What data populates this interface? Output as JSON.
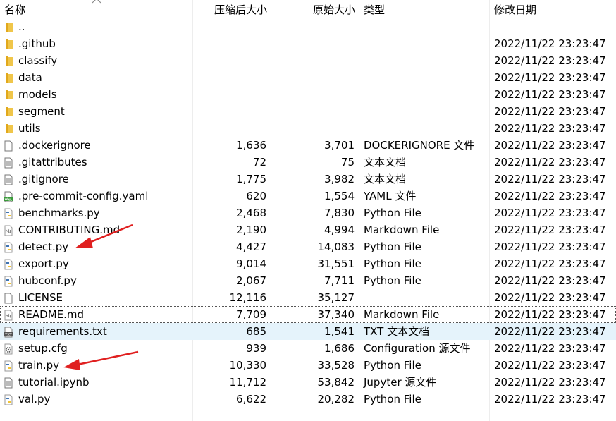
{
  "columns": {
    "name": "名称",
    "compressed": "压缩后大小",
    "original": "原始大小",
    "type": "类型",
    "modified": "修改日期"
  },
  "rows": [
    {
      "name": "..",
      "compressed": "",
      "original": "",
      "type": "",
      "modified": "",
      "icon": "folder-icon"
    },
    {
      "name": ".github",
      "compressed": "",
      "original": "",
      "type": "",
      "modified": "2022/11/22 23:23:47",
      "icon": "folder-icon"
    },
    {
      "name": "classify",
      "compressed": "",
      "original": "",
      "type": "",
      "modified": "2022/11/22 23:23:47",
      "icon": "folder-icon"
    },
    {
      "name": "data",
      "compressed": "",
      "original": "",
      "type": "",
      "modified": "2022/11/22 23:23:47",
      "icon": "folder-icon"
    },
    {
      "name": "models",
      "compressed": "",
      "original": "",
      "type": "",
      "modified": "2022/11/22 23:23:47",
      "icon": "folder-icon"
    },
    {
      "name": "segment",
      "compressed": "",
      "original": "",
      "type": "",
      "modified": "2022/11/22 23:23:47",
      "icon": "folder-icon"
    },
    {
      "name": "utils",
      "compressed": "",
      "original": "",
      "type": "",
      "modified": "2022/11/22 23:23:47",
      "icon": "folder-icon"
    },
    {
      "name": ".dockerignore",
      "compressed": "1,636",
      "original": "3,701",
      "type": "DOCKERIGNORE 文件",
      "modified": "2022/11/22 23:23:47",
      "icon": "blank-file-icon"
    },
    {
      "name": ".gitattributes",
      "compressed": "72",
      "original": "75",
      "type": "文本文档",
      "modified": "2022/11/22 23:23:47",
      "icon": "text-file-icon"
    },
    {
      "name": ".gitignore",
      "compressed": "1,775",
      "original": "3,982",
      "type": "文本文档",
      "modified": "2022/11/22 23:23:47",
      "icon": "text-file-icon"
    },
    {
      "name": ".pre-commit-config.yaml",
      "compressed": "620",
      "original": "1,554",
      "type": "YAML 文件",
      "modified": "2022/11/22 23:23:47",
      "icon": "yaml-file-icon"
    },
    {
      "name": "benchmarks.py",
      "compressed": "2,468",
      "original": "7,830",
      "type": "Python File",
      "modified": "2022/11/22 23:23:47",
      "icon": "python-file-icon"
    },
    {
      "name": "CONTRIBUTING.md",
      "compressed": "2,190",
      "original": "4,994",
      "type": "Markdown File",
      "modified": "2022/11/22 23:23:47",
      "icon": "markdown-file-icon"
    },
    {
      "name": "detect.py",
      "compressed": "4,427",
      "original": "14,083",
      "type": "Python File",
      "modified": "2022/11/22 23:23:47",
      "icon": "python-file-icon"
    },
    {
      "name": "export.py",
      "compressed": "9,014",
      "original": "31,551",
      "type": "Python File",
      "modified": "2022/11/22 23:23:47",
      "icon": "python-file-icon"
    },
    {
      "name": "hubconf.py",
      "compressed": "2,067",
      "original": "7,711",
      "type": "Python File",
      "modified": "2022/11/22 23:23:47",
      "icon": "python-file-icon"
    },
    {
      "name": "LICENSE",
      "compressed": "12,116",
      "original": "35,127",
      "type": "",
      "modified": "2022/11/22 23:23:47",
      "icon": "blank-file-icon"
    },
    {
      "name": "README.md",
      "compressed": "7,709",
      "original": "37,340",
      "type": "Markdown File",
      "modified": "2022/11/22 23:23:47",
      "icon": "markdown-file-icon"
    },
    {
      "name": "requirements.txt",
      "compressed": "685",
      "original": "1,541",
      "type": "TXT 文本文档",
      "modified": "2022/11/22 23:23:47",
      "icon": "txt-file-icon"
    },
    {
      "name": "setup.cfg",
      "compressed": "939",
      "original": "1,686",
      "type": "Configuration 源文件",
      "modified": "2022/11/22 23:23:47",
      "icon": "config-file-icon"
    },
    {
      "name": "train.py",
      "compressed": "10,330",
      "original": "33,528",
      "type": "Python File",
      "modified": "2022/11/22 23:23:47",
      "icon": "python-file-icon"
    },
    {
      "name": "tutorial.ipynb",
      "compressed": "11,712",
      "original": "53,842",
      "type": "Jupyter 源文件",
      "modified": "2022/11/22 23:23:47",
      "icon": "text-file-icon"
    },
    {
      "name": "val.py",
      "compressed": "6,622",
      "original": "20,282",
      "type": "Python File",
      "modified": "2022/11/22 23:23:47",
      "icon": "python-file-icon"
    }
  ],
  "colors": {
    "selected_row": "#e5f3fb",
    "folder": "#e8b928",
    "annotation_arrow": "#e02020"
  }
}
